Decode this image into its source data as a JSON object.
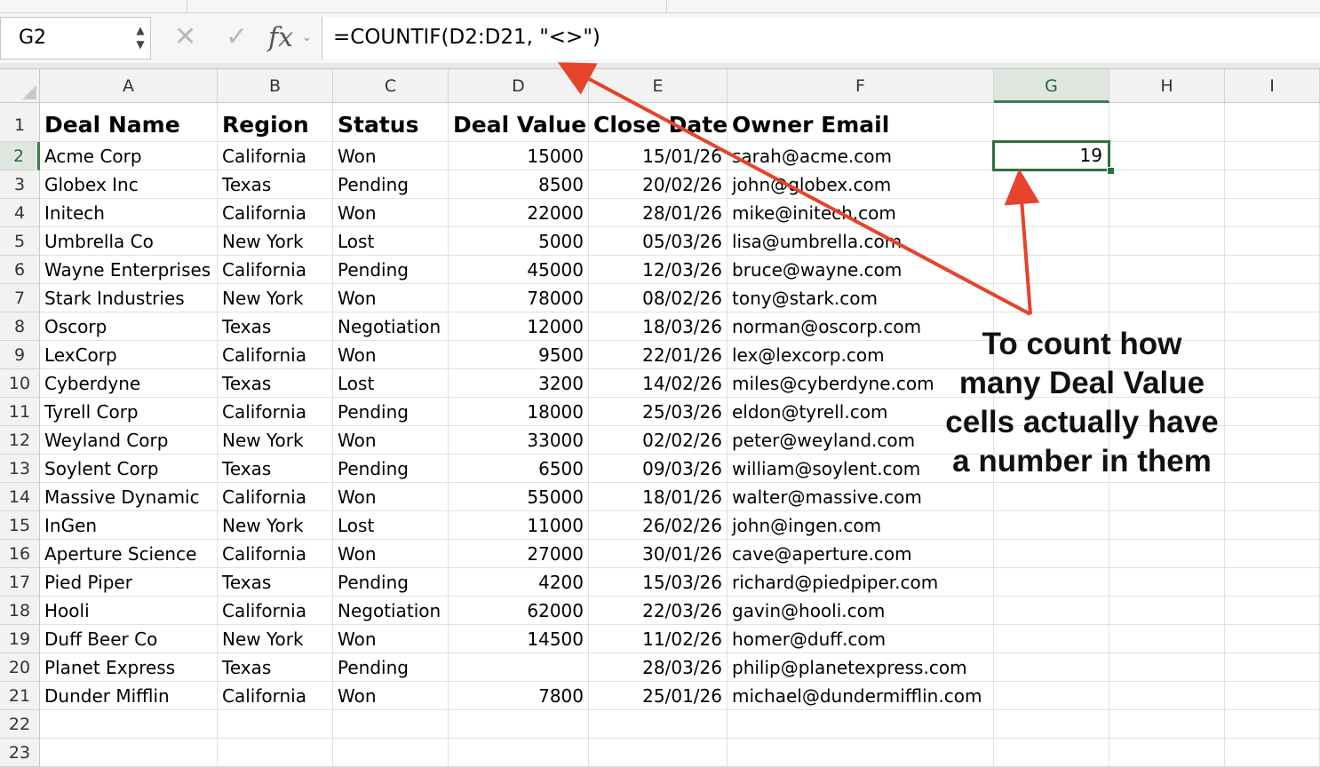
{
  "name_box": {
    "value": "G2"
  },
  "formula_bar": {
    "formula": "=COUNTIF(D2:D21, \"<>\")"
  },
  "icons": {
    "cancel": "x-icon",
    "enter": "checkmark-icon",
    "function": "fx-icon"
  },
  "fx_label": "fx",
  "columns": [
    "A",
    "B",
    "C",
    "D",
    "E",
    "F",
    "G",
    "H",
    "I"
  ],
  "rows": [
    "1",
    "2",
    "3",
    "4",
    "5",
    "6",
    "7",
    "8",
    "9",
    "10",
    "11",
    "12",
    "13",
    "14",
    "15",
    "16",
    "17",
    "18",
    "19",
    "20",
    "21",
    "22",
    "23"
  ],
  "headers": [
    "Deal Name",
    "Region",
    "Status",
    "Deal Value",
    "Close Date",
    "Owner Email"
  ],
  "data": [
    [
      "Acme Corp",
      "California",
      "Won",
      "15000",
      "15/01/26",
      "sarah@acme.com"
    ],
    [
      "Globex Inc",
      "Texas",
      "Pending",
      "8500",
      "20/02/26",
      "john@globex.com"
    ],
    [
      "Initech",
      "California",
      "Won",
      "22000",
      "28/01/26",
      "mike@initech.com"
    ],
    [
      "Umbrella Co",
      "New York",
      "Lost",
      "5000",
      "05/03/26",
      "lisa@umbrella.com"
    ],
    [
      "Wayne Enterprises",
      "California",
      "Pending",
      "45000",
      "12/03/26",
      "bruce@wayne.com"
    ],
    [
      "Stark Industries",
      "New York",
      "Won",
      "78000",
      "08/02/26",
      "tony@stark.com"
    ],
    [
      "Oscorp",
      "Texas",
      "Negotiation",
      "12000",
      "18/03/26",
      "norman@oscorp.com"
    ],
    [
      "LexCorp",
      "California",
      "Won",
      "9500",
      "22/01/26",
      "lex@lexcorp.com"
    ],
    [
      "Cyberdyne",
      "Texas",
      "Lost",
      "3200",
      "14/02/26",
      "miles@cyberdyne.com"
    ],
    [
      "Tyrell Corp",
      "California",
      "Pending",
      "18000",
      "25/03/26",
      "eldon@tyrell.com"
    ],
    [
      "Weyland Corp",
      "New York",
      "Won",
      "33000",
      "02/02/26",
      "peter@weyland.com"
    ],
    [
      "Soylent Corp",
      "Texas",
      "Pending",
      "6500",
      "09/03/26",
      "william@soylent.com"
    ],
    [
      "Massive Dynamic",
      "California",
      "Won",
      "55000",
      "18/01/26",
      "walter@massive.com"
    ],
    [
      "InGen",
      "New York",
      "Lost",
      "11000",
      "26/02/26",
      "john@ingen.com"
    ],
    [
      "Aperture Science",
      "California",
      "Won",
      "27000",
      "30/01/26",
      "cave@aperture.com"
    ],
    [
      "Pied Piper",
      "Texas",
      "Pending",
      "4200",
      "15/03/26",
      "richard@piedpiper.com"
    ],
    [
      "Hooli",
      "California",
      "Negotiation",
      "62000",
      "22/03/26",
      "gavin@hooli.com"
    ],
    [
      "Duff Beer Co",
      "New York",
      "Won",
      "14500",
      "11/02/26",
      "homer@duff.com"
    ],
    [
      "Planet Express",
      "Texas",
      "Pending",
      "",
      "28/03/26",
      "philip@planetexpress.com"
    ],
    [
      "Dunder Mifflin",
      "California",
      "Won",
      "7800",
      "25/01/26",
      "michael@dundermifflin.com"
    ]
  ],
  "selected_cell": {
    "address": "G2",
    "value": "19"
  },
  "annotation": {
    "lines": [
      "To count how",
      "many Deal Value",
      "cells actually have",
      "a number in them"
    ],
    "arrow_color": "#e5432a"
  },
  "colors": {
    "selection": "#2f6f3c",
    "header_selected_bg": "#dfe6e0"
  }
}
